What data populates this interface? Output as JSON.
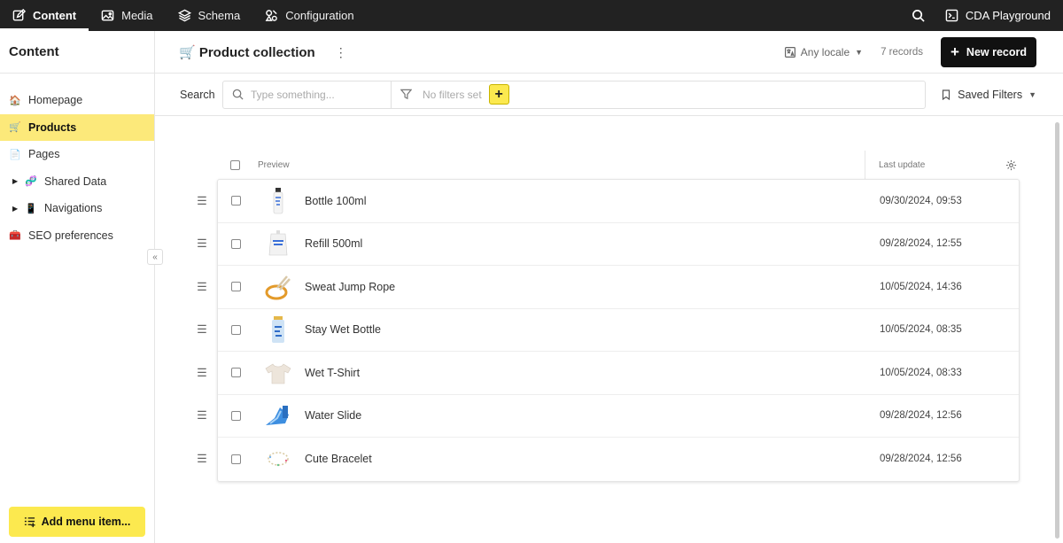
{
  "topnav": {
    "tabs": [
      {
        "label": "Content",
        "icon": "edit-icon",
        "active": true
      },
      {
        "label": "Media",
        "icon": "image-icon",
        "active": false
      },
      {
        "label": "Schema",
        "icon": "layers-icon",
        "active": false
      },
      {
        "label": "Configuration",
        "icon": "settings-shapes-icon",
        "active": false
      }
    ],
    "project": "CDA Playground"
  },
  "sidebar": {
    "title": "Content",
    "items": [
      {
        "label": "Homepage",
        "emoji": "🏠"
      },
      {
        "label": "Products",
        "emoji": "🛒"
      },
      {
        "label": "Pages",
        "emoji": "📄"
      },
      {
        "label": "Shared Data",
        "emoji": "🧬"
      },
      {
        "label": "Navigations",
        "emoji": "📱"
      },
      {
        "label": "SEO preferences",
        "emoji": "🧰"
      }
    ],
    "add_menu_label": "Add menu item..."
  },
  "header": {
    "title": "🛒 Product collection",
    "kebab": "⋮",
    "locale": "Any locale",
    "records": "7 records",
    "new_record": "New record"
  },
  "search": {
    "label": "Search",
    "placeholder": "Type something...",
    "no_filters": "No filters set",
    "add_filter": "+",
    "saved_filters": "Saved Filters"
  },
  "table": {
    "columns": {
      "preview": "Preview",
      "last_update": "Last update"
    },
    "rows": [
      {
        "name": "Bottle 100ml",
        "date": "09/30/2024, 09:53",
        "thumb": "bottle-thumbnail"
      },
      {
        "name": "Refill 500ml",
        "date": "09/28/2024, 12:55",
        "thumb": "refill-pouch-thumbnail"
      },
      {
        "name": "Sweat Jump Rope",
        "date": "10/05/2024, 14:36",
        "thumb": "jump-rope-thumbnail"
      },
      {
        "name": "Stay Wet Bottle",
        "date": "10/05/2024, 08:35",
        "thumb": "water-bottle-thumbnail"
      },
      {
        "name": "Wet T-Shirt",
        "date": "10/05/2024, 08:33",
        "thumb": "tshirt-thumbnail"
      },
      {
        "name": "Water Slide",
        "date": "09/28/2024, 12:56",
        "thumb": "water-slide-thumbnail"
      },
      {
        "name": "Cute Bracelet",
        "date": "09/28/2024, 12:56",
        "thumb": "bracelet-thumbnail"
      }
    ]
  },
  "colors": {
    "topbar": "#222222",
    "accent": "#fce94f",
    "active_item": "#fce97a",
    "primary_button": "#111111"
  }
}
